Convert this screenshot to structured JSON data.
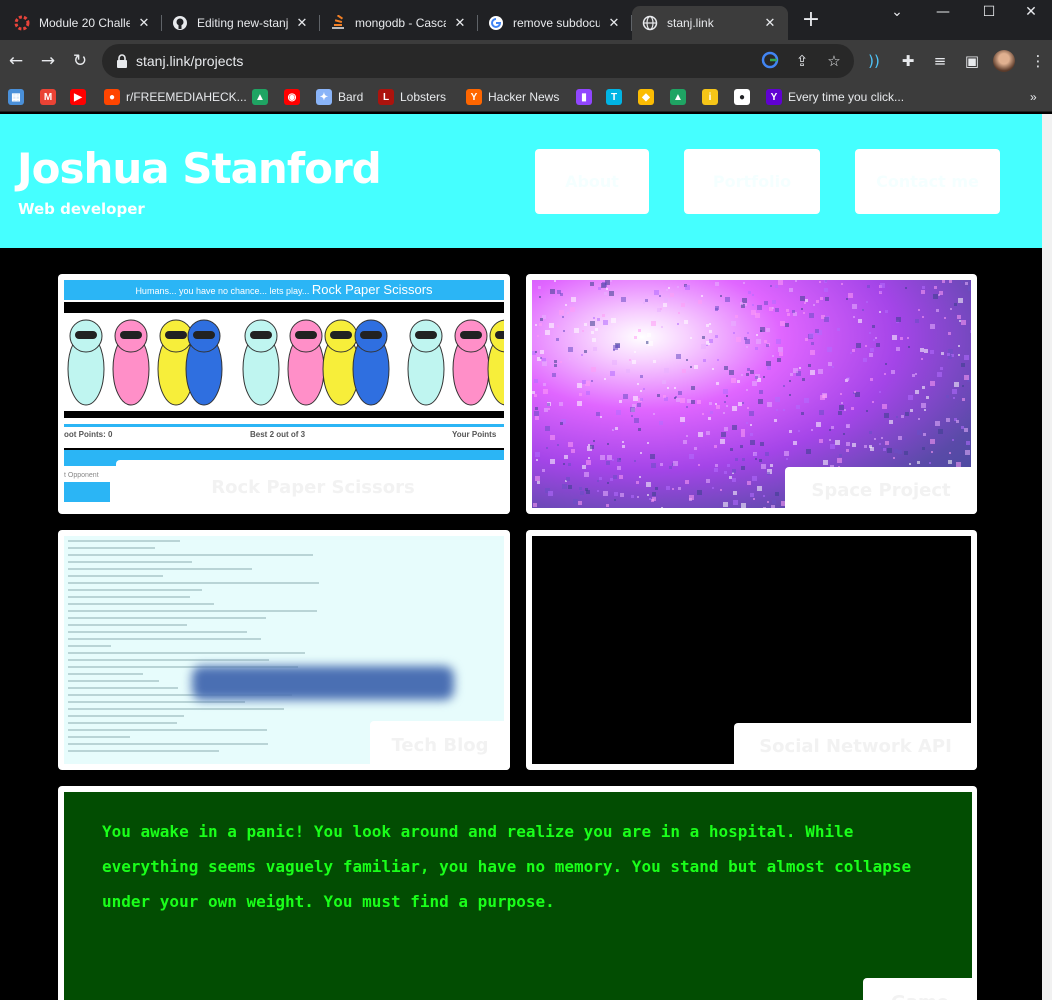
{
  "browser": {
    "tabs": [
      {
        "title": "Module 20 Challe",
        "icon": "bootcamp-icon",
        "active": false
      },
      {
        "title": "Editing new-stanj",
        "icon": "github-icon",
        "active": false
      },
      {
        "title": "mongodb - Casca",
        "icon": "stackoverflow-icon",
        "active": false
      },
      {
        "title": "remove subdocun",
        "icon": "google-icon",
        "active": false
      },
      {
        "title": "stanj.link",
        "icon": "globe-icon",
        "active": true
      }
    ],
    "url": "stanj.link/projects",
    "bookmarks": [
      {
        "label": "",
        "icon": "calendar-icon",
        "color": "#4a90d9"
      },
      {
        "label": "",
        "icon": "gmail-icon",
        "color": "#ea4335"
      },
      {
        "label": "",
        "icon": "youtube-icon",
        "color": "#ff0000"
      },
      {
        "label": "r/FREEMEDIAHECK...",
        "icon": "reddit-icon",
        "color": "#ff4500"
      },
      {
        "label": "",
        "icon": "drive-icon",
        "color": "#1fa463"
      },
      {
        "label": "",
        "icon": "ytmusic-icon",
        "color": "#ff0000"
      },
      {
        "label": "Bard",
        "icon": "bard-icon",
        "color": "#8ab4f8"
      },
      {
        "label": "Lobsters",
        "icon": "lobsters-icon",
        "color": "#ac130d"
      },
      {
        "label": "Hacker News",
        "icon": "hackernews-icon",
        "color": "#ff6600"
      },
      {
        "label": "",
        "icon": "twitch-icon",
        "color": "#9146ff"
      },
      {
        "label": "",
        "icon": "tmdb-icon",
        "color": "#01b4e4"
      },
      {
        "label": "",
        "icon": "keep-icon",
        "color": "#fbbc04"
      },
      {
        "label": "",
        "icon": "drive2-icon",
        "color": "#1fa463"
      },
      {
        "label": "",
        "icon": "imdb-icon",
        "color": "#f5c518"
      },
      {
        "label": "",
        "icon": "github-icon",
        "color": "#ffffff"
      },
      {
        "label": "Every time you click...",
        "icon": "yahoo-icon",
        "color": "#6001d2"
      }
    ]
  },
  "site": {
    "title": "Joshua Stanford",
    "subtitle": "Web developer",
    "nav": [
      "About",
      "Portfolio",
      "Contact me"
    ],
    "colors": {
      "header": "#45ffff",
      "terminal": "#024d02",
      "terminal_text": "#1aff1a"
    }
  },
  "projects": {
    "rps": {
      "banner_small": "Humans... you have no chance... lets play...",
      "banner_big": "Rock Paper Scissors",
      "left_score": "oot Points: 0",
      "mid_score": "Best 2 out of 3",
      "right_score": "Your Points",
      "opponent": "t Opponent",
      "caption": "Rock Paper Scissors"
    },
    "space": {
      "caption": "Space Project"
    },
    "blog": {
      "caption": "Tech Blog"
    },
    "black": {
      "caption": "Social Network API"
    },
    "text_adventure": {
      "story": "You awake in a panic! You look around and realize you are in a hospital. While everything seems vaguely familiar, you have no memory. You stand but almost collapse under your own weight. You must find a purpose.",
      "caption": "Game"
    }
  }
}
